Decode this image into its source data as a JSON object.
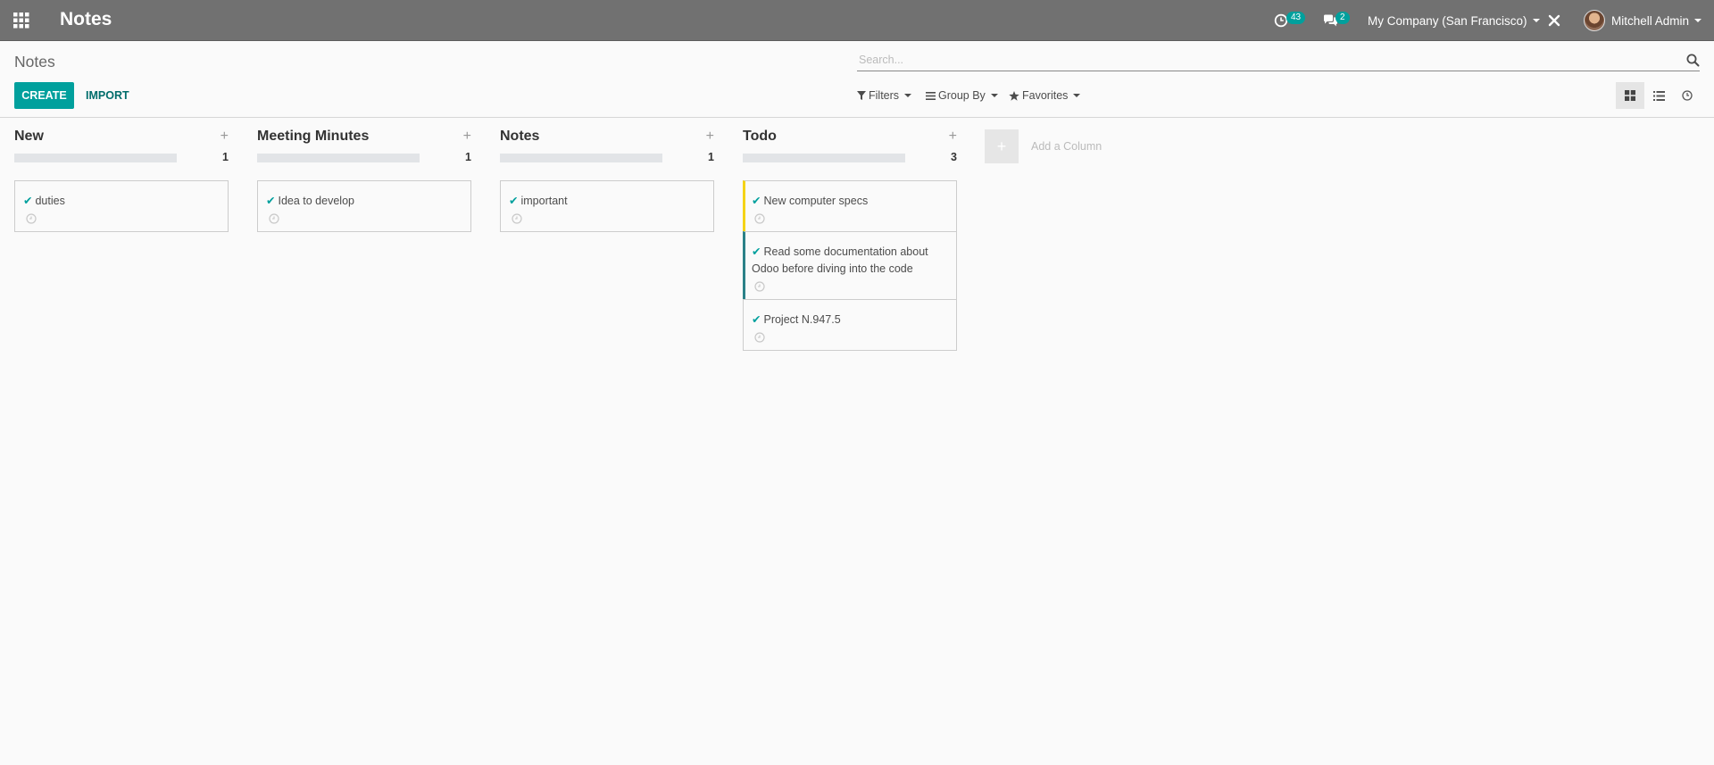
{
  "navbar": {
    "app_title": "Notes",
    "activity_count": "43",
    "messages_count": "2",
    "company": "My Company (San Francisco)",
    "user": "Mitchell Admin"
  },
  "control_panel": {
    "breadcrumb": "Notes",
    "create_label": "CREATE",
    "import_label": "IMPORT",
    "search_placeholder": "Search...",
    "filters_label": "Filters",
    "group_by_label": "Group By",
    "favorites_label": "Favorites"
  },
  "columns": [
    {
      "title": "New",
      "count": "1",
      "cards": [
        {
          "title": "duties",
          "color": "none"
        }
      ]
    },
    {
      "title": "Meeting Minutes",
      "count": "1",
      "cards": [
        {
          "title": "Idea to develop",
          "color": "none"
        }
      ]
    },
    {
      "title": "Notes",
      "count": "1",
      "cards": [
        {
          "title": "important",
          "color": "none"
        }
      ]
    },
    {
      "title": "Todo",
      "count": "3",
      "cards": [
        {
          "title": "New computer specs",
          "color": "#f4d316"
        },
        {
          "title": "Read some documentation about Odoo before diving into the code",
          "color": "#2b8188"
        },
        {
          "title": "Project N.947.5",
          "color": "none"
        }
      ]
    }
  ],
  "add_column_label": "Add a Column",
  "colors": {
    "navbar": "#717171",
    "primary": "#00a09d"
  }
}
